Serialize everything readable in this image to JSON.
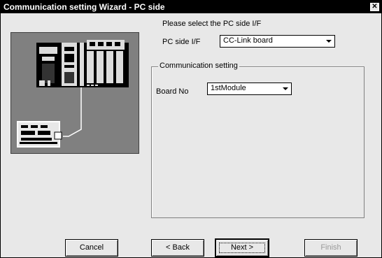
{
  "window": {
    "title": "Communication setting Wizard - PC side",
    "close_icon": "close-icon"
  },
  "prompt": "Please select the PC side I/F",
  "pc_side": {
    "label": "PC side I/F",
    "value": "CC-Link board"
  },
  "group": {
    "legend": "Communication setting",
    "board_no_label": "Board No",
    "board_no_value": "1stModule"
  },
  "buttons": {
    "cancel": "Cancel",
    "back": "< Back",
    "next": "Next >",
    "finish": "Finish"
  },
  "illustration": "plc-system-illustration"
}
